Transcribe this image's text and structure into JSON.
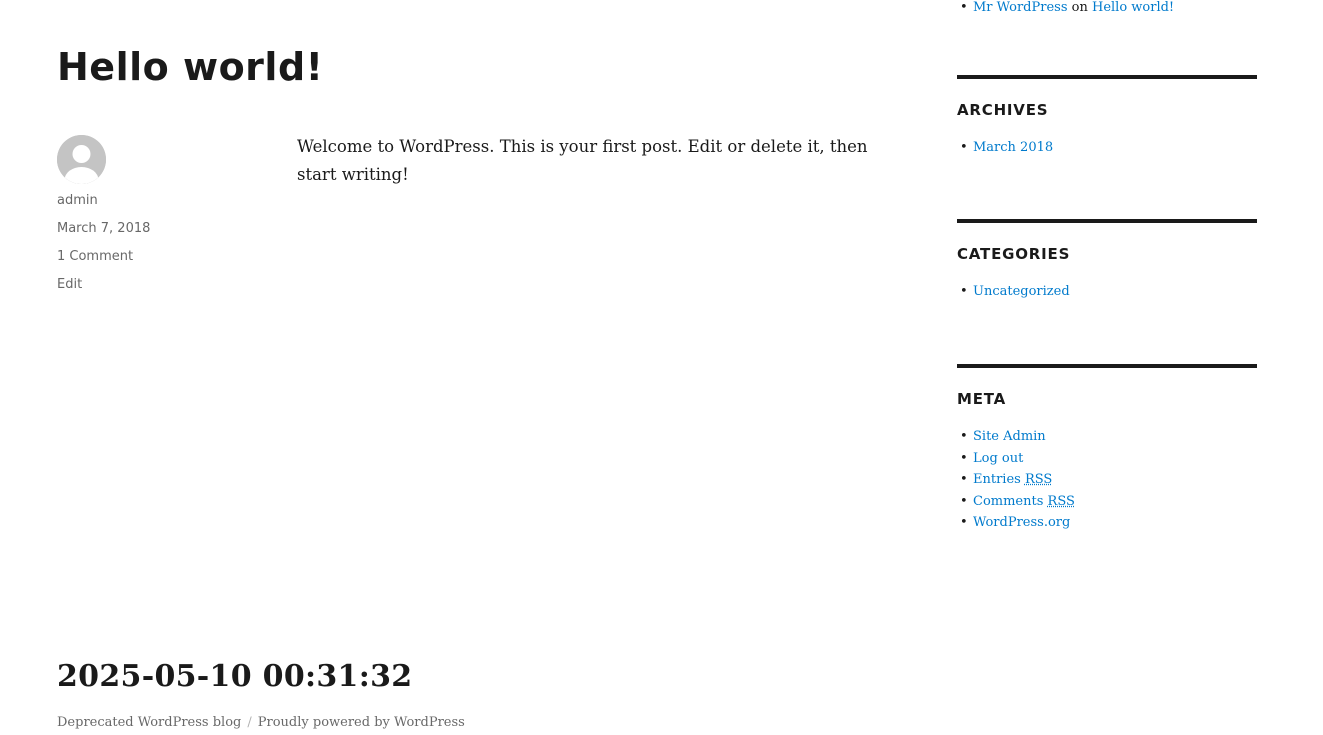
{
  "post": {
    "title": "Hello world!",
    "author": "admin",
    "date": "March 7, 2018",
    "comments": "1 Comment",
    "edit": "Edit",
    "content": "Welcome to WordPress. This is your first post. Edit or delete it, then start writing!"
  },
  "sidebar": {
    "recent_comments": {
      "author": "Mr WordPress",
      "on": "on",
      "post": "Hello world!"
    },
    "archives": {
      "title": "ARCHIVES",
      "items": [
        "March 2018"
      ]
    },
    "categories": {
      "title": "CATEGORIES",
      "items": [
        "Uncategorized"
      ]
    },
    "meta": {
      "title": "META",
      "site_admin": "Site Admin",
      "log_out": "Log out",
      "entries": "Entries",
      "comments": "Comments",
      "rss": "RSS",
      "wordpress_org": "WordPress.org"
    }
  },
  "footer": {
    "timestamp": "2025-05-10 00:31:32",
    "blog_link": "Deprecated WordPress blog",
    "separator": "/",
    "powered_by": "Proudly powered by WordPress"
  },
  "colors": {
    "link": "#007acc",
    "text": "#1a1a1a",
    "meta": "#686868",
    "avatar": "#c4c4c4"
  }
}
